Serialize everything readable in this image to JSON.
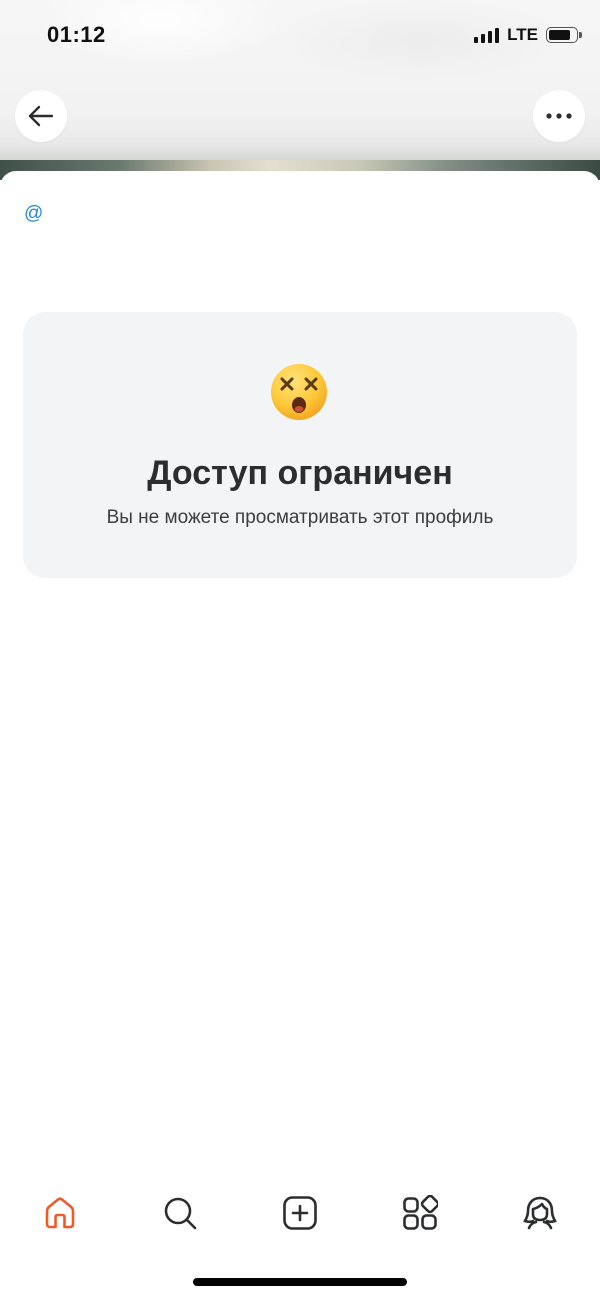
{
  "status_bar": {
    "time": "01:12",
    "network": "LTE",
    "signal_bars": 4,
    "battery_level": 0.85
  },
  "header": {
    "back_icon": "arrow-left-icon",
    "more_icon": "more-horizontal-icon"
  },
  "profile": {
    "handle_prefix": "@"
  },
  "restricted": {
    "emoji": "dizzy-face-emoji",
    "title": "Доступ ограничен",
    "subtitle": "Вы не можете просматривать этот профиль"
  },
  "tab_bar": {
    "items": [
      {
        "name": "home",
        "icon": "home-icon",
        "active": true
      },
      {
        "name": "search",
        "icon": "search-icon",
        "active": false
      },
      {
        "name": "create",
        "icon": "add-square-icon",
        "active": false
      },
      {
        "name": "services",
        "icon": "services-grid-icon",
        "active": false
      },
      {
        "name": "profile",
        "icon": "profile-icon",
        "active": false
      }
    ]
  },
  "colors": {
    "accent": "#f05a28",
    "link": "#2a88d5",
    "icon": "#2c2d2e",
    "card_bg": "#f3f4f6"
  }
}
